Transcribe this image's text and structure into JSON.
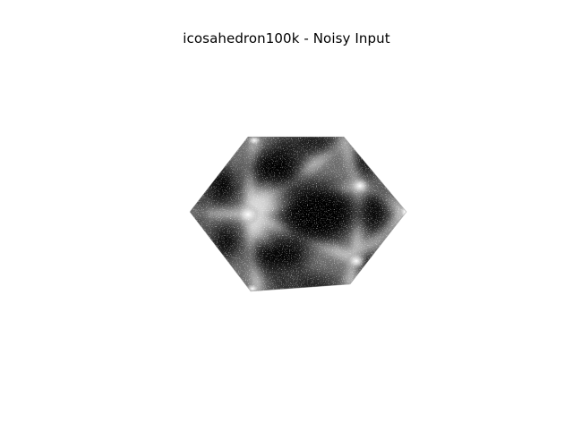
{
  "figure": {
    "title": "icosahedron100k - Noisy Input"
  },
  "colors": {
    "background": "#ffffff",
    "object_dark": "#000000",
    "object_light": "#ffffff"
  }
}
